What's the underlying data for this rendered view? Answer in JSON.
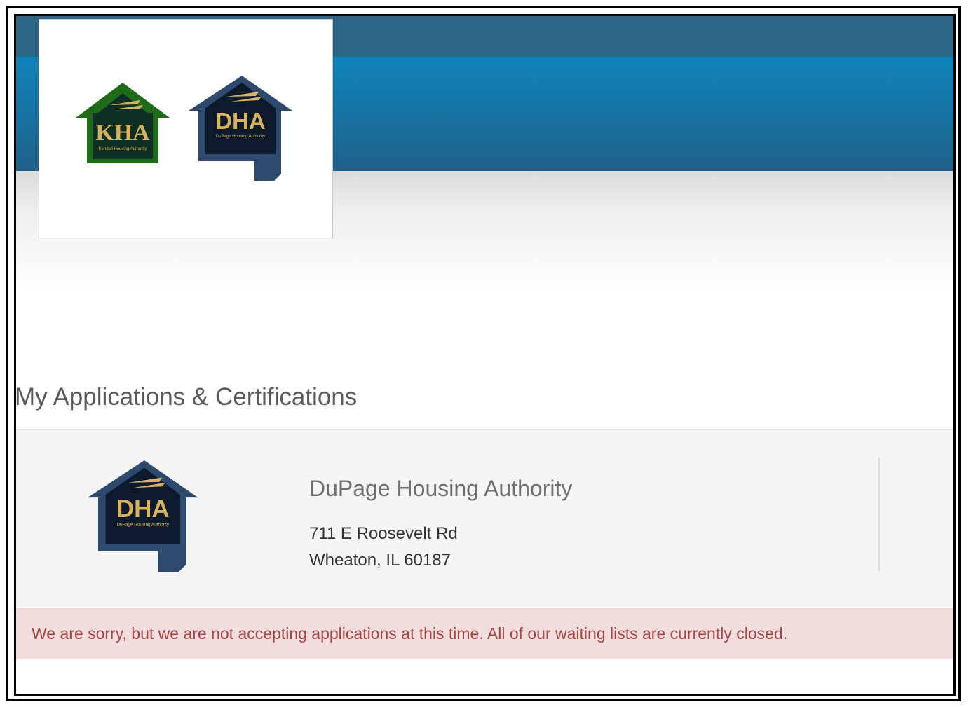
{
  "header": {
    "logos": [
      {
        "name": "kha-logo",
        "text": "KHA",
        "subtext": "Kendall Housing Authority",
        "color": "#1f6b1a"
      },
      {
        "name": "dha-logo",
        "text": "DHA",
        "subtext": "DuPage Housing Authority",
        "color": "#2d4a6e"
      }
    ],
    "colors": {
      "topbar": "#2c6684",
      "navbar": "#1183b9"
    }
  },
  "main": {
    "page_title": "My Applications & Certifications",
    "agency": {
      "name": "DuPage Housing Authority",
      "address_line1": "711 E Roosevelt Rd",
      "address_line2": "Wheaton, IL 60187",
      "logo_text": "DHA",
      "logo_subtext": "DuPage Housing Authority"
    },
    "alert": {
      "message": "We are sorry, but we are not accepting applications at this time. All of our waiting lists are currently closed.",
      "color": "#a94442",
      "background": "#f2dede"
    }
  }
}
